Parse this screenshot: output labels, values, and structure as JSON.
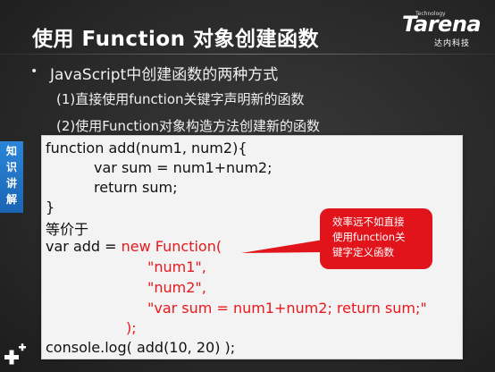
{
  "title": "使用 Function 对象创建函数",
  "logo": {
    "brand": "Tarena",
    "sub": "Technology",
    "cn": "达内科技"
  },
  "bullet": "JavaScript中创建函数的两种方式",
  "sub_items": [
    "(1)直接使用function关键字声明新的函数",
    "(2)使用Function对象构造方法创建新的函数"
  ],
  "side_tab": [
    "知",
    "识",
    "讲",
    "解"
  ],
  "code": {
    "line1": "function add(num1, num2){",
    "line2": "var sum = num1+num2;",
    "line3": "return sum;",
    "line4": "}",
    "line5": "等价于",
    "line6_black": "var add = ",
    "line6_red": "new Function(",
    "line7": "\"num1\",",
    "line8": "\"num2\",",
    "line9": "\"var sum = num1+num2; return sum;\"",
    "line10": ");",
    "line11": "console.log( add(10, 20)  );"
  },
  "callout": [
    "效率远不如直接",
    "使用function关",
    "键字定义函数"
  ],
  "colors": {
    "accent_red": "#e2141b",
    "side_tab_blue": "#1f72c6",
    "code_bg": "#f3f3f3"
  }
}
